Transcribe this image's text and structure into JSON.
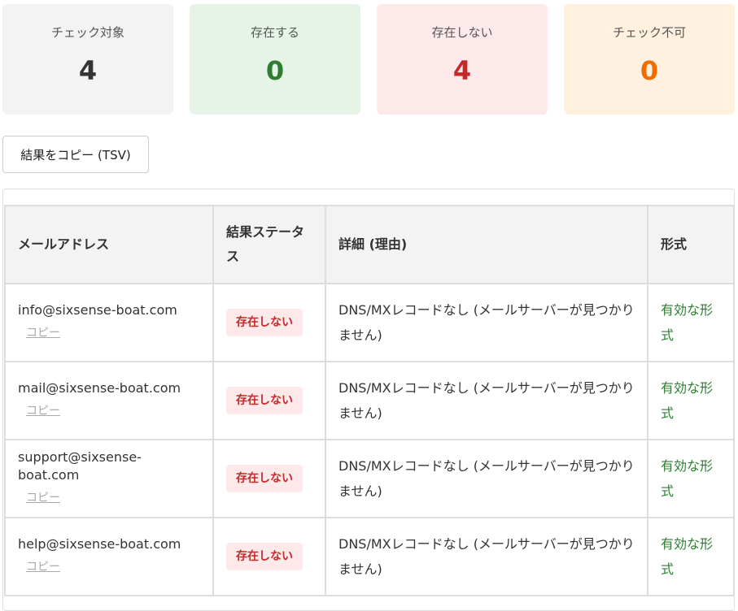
{
  "summary": {
    "target": {
      "label": "チェック対象",
      "value": "4"
    },
    "exists": {
      "label": "存在する",
      "value": "0"
    },
    "missing": {
      "label": "存在しない",
      "value": "4"
    },
    "unknown": {
      "label": "チェック不可",
      "value": "0"
    }
  },
  "toolbar": {
    "copy_label": "結果をコピー (TSV)"
  },
  "table": {
    "headers": {
      "email": "メールアドレス",
      "status": "結果ステータス",
      "detail": "詳細 (理由)",
      "format": "形式"
    },
    "rows": [
      {
        "email": "info@sixsense-boat.com",
        "copy": "コピー",
        "status": "存在しない",
        "detail": "DNS/MXレコードなし (メールサーバーが見つかりません)",
        "format": "有効な形式"
      },
      {
        "email": "mail@sixsense-boat.com",
        "copy": "コピー",
        "status": "存在しない",
        "detail": "DNS/MXレコードなし (メールサーバーが見つかりません)",
        "format": "有効な形式"
      },
      {
        "email": "support@sixsense-boat.com",
        "copy": "コピー",
        "status": "存在しない",
        "detail": "DNS/MXレコードなし (メールサーバーが見つかりません)",
        "format": "有効な形式"
      },
      {
        "email": "help@sixsense-boat.com",
        "copy": "コピー",
        "status": "存在しない",
        "detail": "DNS/MXレコードなし (メールサーバーが見つかりません)",
        "format": "有効な形式"
      }
    ]
  },
  "colors": {
    "exists": "#2e7d32",
    "missing": "#c62828",
    "unknown": "#ef6c00",
    "neutral": "#333333"
  }
}
